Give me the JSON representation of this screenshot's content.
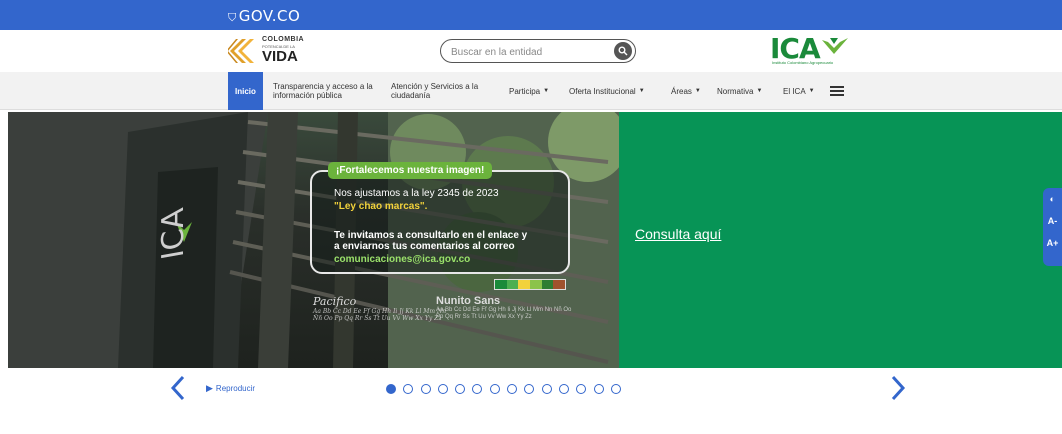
{
  "gov": {
    "logo_text": "GOV.CO"
  },
  "colombia": {
    "line1": "COLOMBIA",
    "line2": "POTENCIA DE LA",
    "line3": "VIDA"
  },
  "search": {
    "placeholder": "Buscar en la entidad"
  },
  "ica": {
    "letters": "ICA",
    "subtitle": "Instituto Colombiano Agropecuario"
  },
  "nav": {
    "items": [
      {
        "label": "Inicio"
      },
      {
        "label": "Transparencia y acceso a la información pública"
      },
      {
        "label": "Atención y Servicios a la ciudadanía"
      },
      {
        "label": "Participa"
      },
      {
        "label": "Oferta Institucional"
      },
      {
        "label": "Áreas"
      },
      {
        "label": "Normativa"
      },
      {
        "label": "El ICA"
      }
    ]
  },
  "banner": {
    "badge": "¡Fortalecemos nuestra imagen!",
    "line1": "Nos ajustamos a la ley 2345 de 2023",
    "line2": "\"Ley chao marcas\".",
    "line3": "Te invitamos a consultarlo en el enlace y",
    "line4": "a enviarnos tus comentarios al correo",
    "email": "comunicaciones@ica.gov.co",
    "font1_title": "Pacifico",
    "font1_sample": "Aa Bb Cc Dd Ee Ff Gg Hh Ii Jj Kk Ll Mm Nn Ññ Oo Pp Qq Rr Ss Tt Uu Vv Ww Xx Yy Zz",
    "font2_title": "Nunito Sans",
    "font2_sample": "Aa Bb Cc Dd Ee Ff Gg Hh Ii Jj Kk Ll Mm Nn Ññ Oo Pp Qq Rr Ss Tt Uu Vv Ww Xx Yy Zz",
    "building_sign": "ICA",
    "link": "Consulta aquí",
    "strip_colors": [
      "#1a8a3a",
      "#4caf50",
      "#f2d23b",
      "#8bc34a",
      "#2e7d32",
      "#a0522d"
    ]
  },
  "accessibility": {
    "contrast": "◐",
    "decrease": "A-",
    "increase": "A+"
  },
  "slider": {
    "play_label": "Reproducir",
    "dot_count": 14,
    "active_index": 0
  },
  "colors": {
    "gov_blue": "#3366cc",
    "ica_green": "#079456",
    "badge_green": "#6bb33c"
  }
}
